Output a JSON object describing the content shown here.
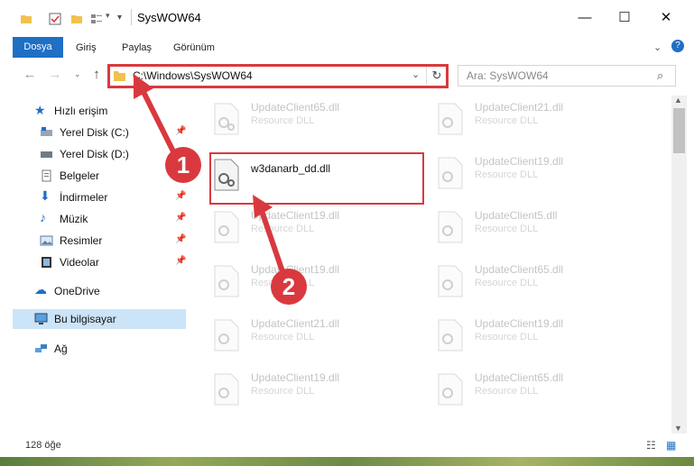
{
  "window": {
    "title": "SysWOW64"
  },
  "ribbon": {
    "tabs": [
      "Dosya",
      "Giriş",
      "Paylaş",
      "Görünüm"
    ]
  },
  "address": {
    "path": "C:\\Windows\\SysWOW64"
  },
  "search": {
    "placeholder": "Ara: SysWOW64"
  },
  "nav": {
    "quick_access": "Hızlı erişim",
    "items": [
      "Yerel Disk (C:)",
      "Yerel Disk (D:)",
      "Belgeler",
      "İndirmeler",
      "Müzik",
      "Resimler",
      "Videolar"
    ],
    "onedrive": "OneDrive",
    "this_pc": "Bu bilgisayar",
    "network": "Ağ"
  },
  "files": {
    "focused": "w3danarb_dd.dll",
    "left": [
      {
        "name": "UpdateClient65.dll",
        "type": "Resource DLL"
      },
      {
        "name": "UpdateClient19.dll",
        "type": "Resource DLL"
      },
      {
        "name": "UpdateClient19.dll",
        "type": "Resource DLL"
      },
      {
        "name": "UpdateClient21.dll",
        "type": "Resource DLL"
      },
      {
        "name": "UpdateClient19.dll",
        "type": "Resource DLL"
      }
    ],
    "right": [
      {
        "name": "UpdateClient21.dll",
        "type": "Resource DLL"
      },
      {
        "name": "UpdateClient19.dll",
        "type": "Resource DLL"
      },
      {
        "name": "UpdateClient5.dll",
        "type": "Resource DLL"
      },
      {
        "name": "UpdateClient65.dll",
        "type": "Resource DLL"
      },
      {
        "name": "UpdateClient19.dll",
        "type": "Resource DLL"
      },
      {
        "name": "UpdateClient65.dll",
        "type": "Resource DLL"
      }
    ]
  },
  "status": {
    "count": "128 öğe"
  },
  "callouts": [
    "1",
    "2"
  ],
  "colors": {
    "accent": "#1f6fc5",
    "highlight": "#d9393e"
  }
}
